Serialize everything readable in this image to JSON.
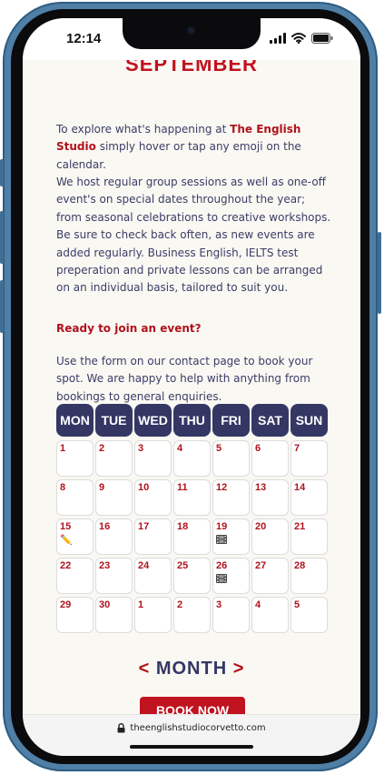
{
  "status_bar": {
    "time": "12:14"
  },
  "calendar_title": "SEPTEMBER",
  "intro": {
    "before": "To explore what's happening at ",
    "studio": "The English Studio",
    "after": " simply hover or tap any emoji on the calendar."
  },
  "description": "We host regular group sessions as well as one-off event's on special dates throughout the year; from seasonal celebrations to creative workshops. Be sure to check back often, as new events are added regularly. Business English, IELTS test preperation and private lessons can be arranged on an individual basis, tailored to suit you.",
  "cta_heading": "Ready to join an event?",
  "cta_text": "Use the form on our contact page to book your spot. We are happy to help with anything from bookings to general enquiries.",
  "weekdays": [
    "MON",
    "TUE",
    "WED",
    "THU",
    "FRI",
    "SAT",
    "SUN"
  ],
  "days": [
    {
      "n": "1"
    },
    {
      "n": "2"
    },
    {
      "n": "3"
    },
    {
      "n": "4"
    },
    {
      "n": "5"
    },
    {
      "n": "6"
    },
    {
      "n": "7"
    },
    {
      "n": "8"
    },
    {
      "n": "9"
    },
    {
      "n": "10"
    },
    {
      "n": "11"
    },
    {
      "n": "12"
    },
    {
      "n": "13"
    },
    {
      "n": "14"
    },
    {
      "n": "15",
      "icon": "pencil-icon",
      "glyph": "✏️"
    },
    {
      "n": "16"
    },
    {
      "n": "17"
    },
    {
      "n": "18"
    },
    {
      "n": "19",
      "icon": "film-icon"
    },
    {
      "n": "20"
    },
    {
      "n": "21"
    },
    {
      "n": "22"
    },
    {
      "n": "23"
    },
    {
      "n": "24"
    },
    {
      "n": "25"
    },
    {
      "n": "26",
      "icon": "film-icon"
    },
    {
      "n": "27"
    },
    {
      "n": "28"
    },
    {
      "n": "29"
    },
    {
      "n": "30"
    },
    {
      "n": "1"
    },
    {
      "n": "2"
    },
    {
      "n": "3"
    },
    {
      "n": "4"
    },
    {
      "n": "5"
    }
  ],
  "month_nav": {
    "prev": "<",
    "label": "MONTH",
    "next": ">"
  },
  "book_button": "BOOK NOW",
  "url": "theenglishstudiocorvetto.com",
  "colors": {
    "accent_red": "#c1121f",
    "navy": "#343764",
    "background": "#faf8f3"
  }
}
